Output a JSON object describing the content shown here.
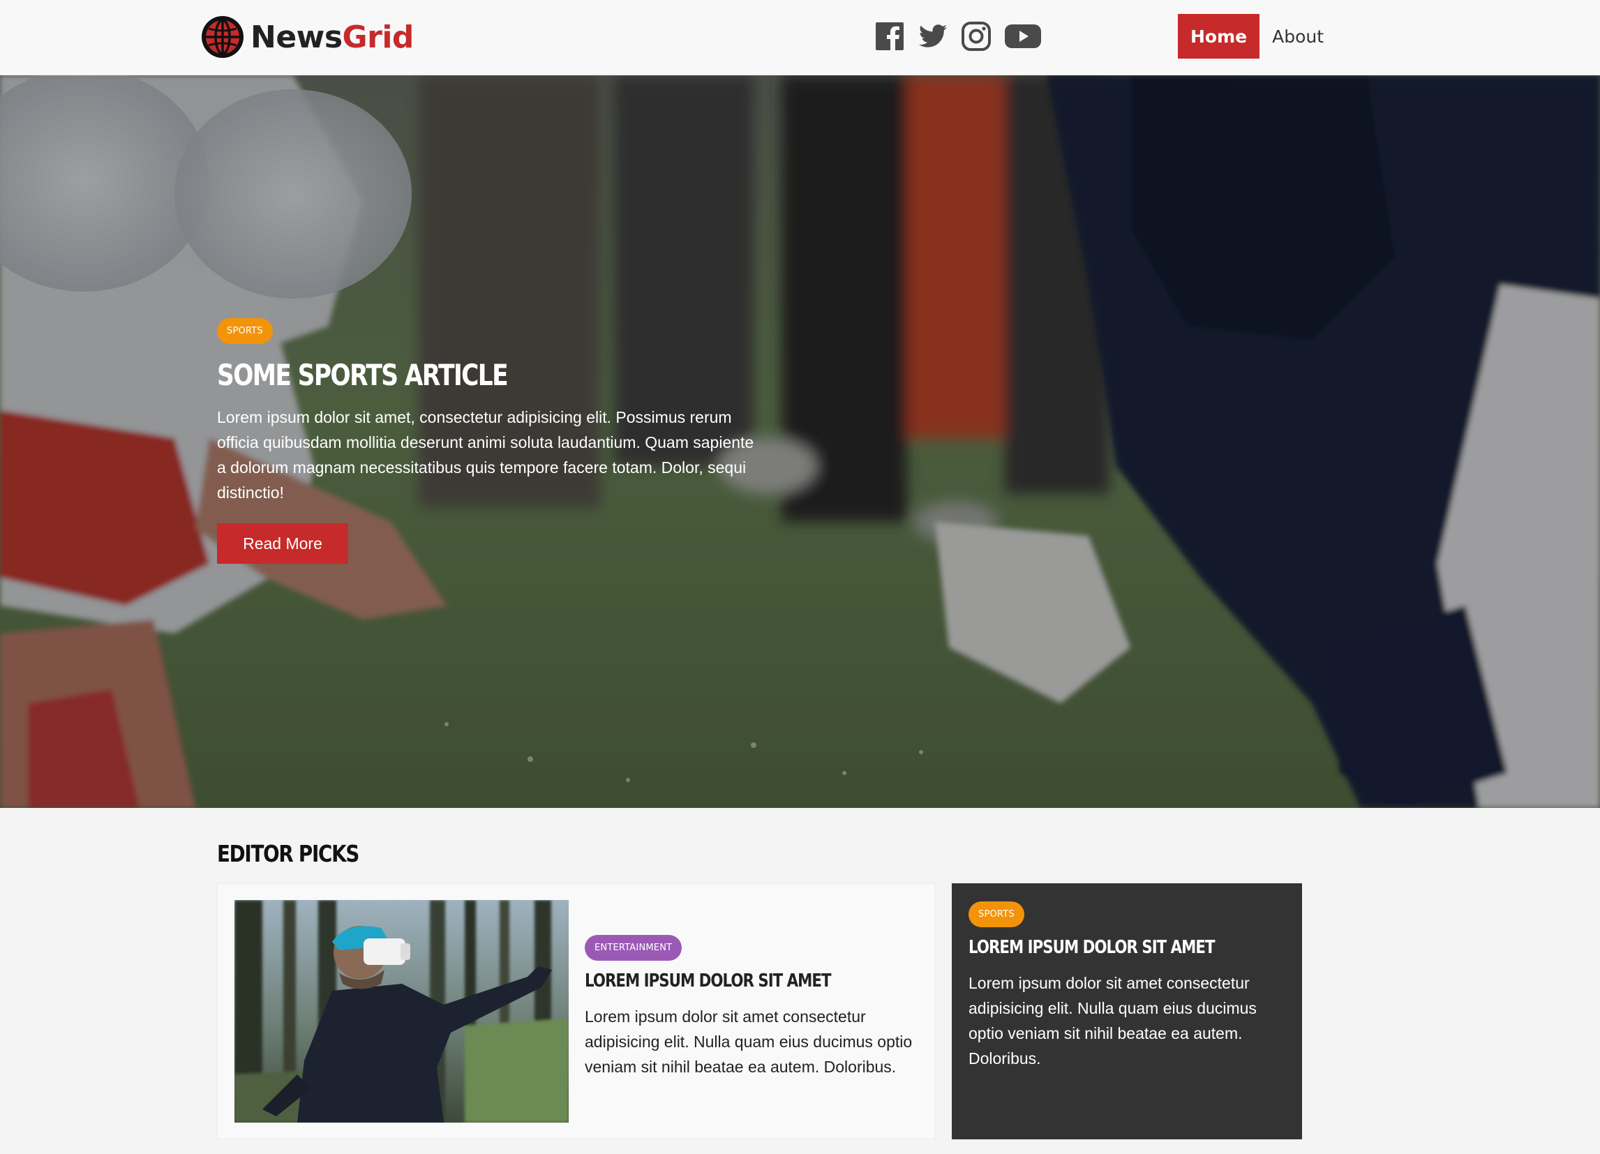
{
  "brand": {
    "name_part1": "News",
    "name_part2": "Grid",
    "logo_icon": "globe-icon",
    "accent_color": "#c62a2a"
  },
  "social": [
    {
      "name": "facebook-icon"
    },
    {
      "name": "twitter-icon"
    },
    {
      "name": "instagram-icon"
    },
    {
      "name": "youtube-icon"
    }
  ],
  "nav": {
    "home_label": "Home",
    "about_label": "About"
  },
  "hero": {
    "category": "Sports",
    "title": "Some Sports Article",
    "text": "Lorem ipsum dolor sit amet, consectetur adipisicing elit. Possimus rerum officia quibusdam mollitia deserunt animi soluta laudantium. Quam sapiente a dolorum magnam necessitatibus quis tempore facere totam. Dolor, sequi distinctio!",
    "button_label": "Read More"
  },
  "editor_picks": {
    "heading": "Editor Picks",
    "cards": [
      {
        "category": "Entertainment",
        "title": "Lorem ipsum dolor sit amet",
        "text": "Lorem ipsum dolor sit amet consectetur adipisicing elit. Nulla quam eius ducimus optio veniam sit nihil beatae ea autem. Doloribus."
      },
      {
        "category": "Sports",
        "title": "Lorem ipsum dolor sit amet",
        "text": "Lorem ipsum dolor sit amet consectetur adipisicing elit. Nulla quam eius ducimus optio veniam sit nihil beatae ea autem. Doloribus."
      }
    ]
  },
  "colors": {
    "badge_sports": "#f2930a",
    "badge_entertainment": "#9b59b6",
    "dark_card": "#333333"
  }
}
